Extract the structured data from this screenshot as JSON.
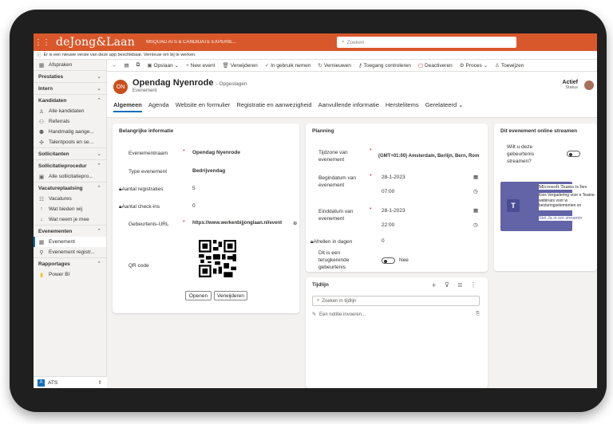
{
  "app": {
    "brand": "deJong&Laan",
    "name": "MSQUAD ATS & CANDIDATE EXPERIE...",
    "search_placeholder": "Zoeken",
    "notice": "Er is een nieuwe versie van deze app beschikbaar. Vernieuw om bij te werken."
  },
  "sidebar": {
    "top_item": "Afspraken",
    "groups": [
      {
        "label": "Prestaties",
        "items": []
      },
      {
        "label": "Intern",
        "items": []
      },
      {
        "label": "Kandidaten",
        "items": [
          "Alle kandidaten",
          "Referrals",
          "Handmatig aange...",
          "Talentpools en se..."
        ]
      },
      {
        "label": "Sollicitanten",
        "items": []
      },
      {
        "label": "Sollicitatieprocedur",
        "items": [
          "Alle sollicitatiepro..."
        ]
      },
      {
        "label": "Vacatureplaatsing",
        "items": [
          "Vacatures",
          "Wat bieden wij",
          "Wat neem je mee"
        ]
      },
      {
        "label": "Evenementen",
        "items": [
          "Evenement",
          "Evenement registr..."
        ]
      },
      {
        "label": "Rapportages",
        "items": [
          "Power BI"
        ]
      }
    ],
    "selected_item": "Evenement",
    "area_badge": "A",
    "area": "ATS"
  },
  "commands": [
    "Opslaan",
    "New event",
    "Verwijderen",
    "In gebruik nemen",
    "Vernieuwen",
    "Toegang controleren",
    "Deactiveren",
    "Proces",
    "Toewijzen"
  ],
  "record": {
    "initials": "ON",
    "title": "Opendag Nyenrode",
    "saved_state": "- Opgeslagen",
    "entity": "Evenement",
    "status_value": "Actief",
    "status_label": "Status"
  },
  "tabs": [
    "Algemeen",
    "Agenda",
    "Website en formulier",
    "Registratie en aanwezigheid",
    "Aanvullende informatie",
    "Herstelitems",
    "Gerelateerd"
  ],
  "important": {
    "title": "Belangrijke informatie",
    "name_label": "Evenementnaam",
    "name_value": "Opendag Nyenrode",
    "type_label": "Type evenement",
    "type_value": "Bedrijvendag",
    "reg_label": "Aantal registraties",
    "reg_value": "5",
    "checkin_label": "Aantal check-ins",
    "checkin_value": "0",
    "url_label": "Gebeurtenis-URL",
    "url_value": "https://www.werkenbijjonglaan.nl/event",
    "qr_label": "QR code",
    "open_btn": "Openen",
    "delete_btn": "Verwijderen"
  },
  "planning": {
    "title": "Planning",
    "tz_label": "Tijdzone van evenement",
    "tz_value": "(GMT+01:00) Amsterdam, Berlijn, Bern, Rom",
    "start_label": "Begindatum van evenement",
    "start_date": "28-1-2023",
    "start_time": "07:00",
    "end_label": "Einddatum van evenement",
    "end_date": "28-1-2023",
    "end_time": "22:00",
    "round_label": "Afrellen in dagen",
    "round_value": "0",
    "recurring_label": "Dit is een terugkerende gebeurtenis",
    "recurring_value": "Nee"
  },
  "timeline": {
    "title": "Tijdlijn",
    "search_placeholder": "Zoeken in tijdlijn",
    "note_placeholder": "Een notitie invoeren..."
  },
  "streaming": {
    "title": "Dit evenement online streamen",
    "question": "Wilt u deze gebeurtenis streamen?",
    "teams_title": "Microsoft Teams is bes",
    "teams_text": "Kies Vergadering voor e Teams-webinars voor w besturingselementen vo",
    "teams_cta": "Stel Ja in om streamin"
  },
  "colors": {
    "accent": "#d9582b",
    "brand_blue": "#0f6cbd",
    "teams": "#6264a7"
  }
}
